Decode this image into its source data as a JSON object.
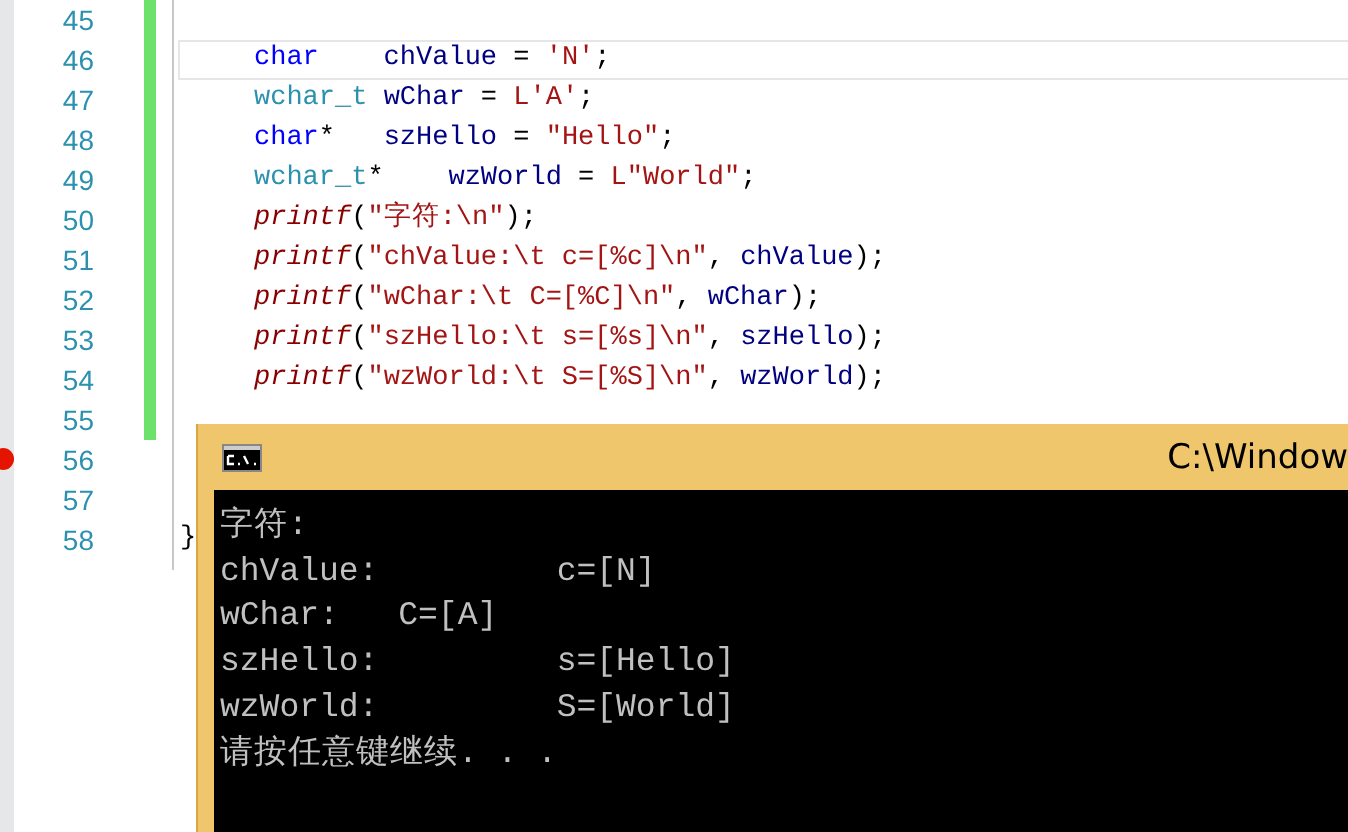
{
  "editor": {
    "lines": [
      {
        "number": "45",
        "indented": false,
        "current": false,
        "breakpoint": false
      },
      {
        "number": "46",
        "indented": true,
        "current": true,
        "breakpoint": false,
        "tokens": [
          {
            "kind": "keyword",
            "text": "char"
          },
          {
            "kind": "ident",
            "text": "    chValue"
          },
          {
            "kind": "plain",
            "text": " = "
          },
          {
            "kind": "string",
            "text": "'N'"
          },
          {
            "kind": "plain",
            "text": ";"
          }
        ]
      },
      {
        "number": "47",
        "indented": true,
        "current": false,
        "breakpoint": false,
        "tokens": [
          {
            "kind": "type",
            "text": "wchar_t"
          },
          {
            "kind": "ident",
            "text": " wChar"
          },
          {
            "kind": "plain",
            "text": " = "
          },
          {
            "kind": "string",
            "text": "L'A'"
          },
          {
            "kind": "plain",
            "text": ";"
          }
        ]
      },
      {
        "number": "48",
        "indented": true,
        "current": false,
        "breakpoint": false,
        "tokens": [
          {
            "kind": "keyword",
            "text": "char"
          },
          {
            "kind": "plain",
            "text": "*"
          },
          {
            "kind": "ident",
            "text": "   szHello"
          },
          {
            "kind": "plain",
            "text": " = "
          },
          {
            "kind": "string",
            "text": "\"Hello\""
          },
          {
            "kind": "plain",
            "text": ";"
          }
        ]
      },
      {
        "number": "49",
        "indented": true,
        "current": false,
        "breakpoint": false,
        "tokens": [
          {
            "kind": "type",
            "text": "wchar_t"
          },
          {
            "kind": "plain",
            "text": "*"
          },
          {
            "kind": "ident",
            "text": "    wzWorld"
          },
          {
            "kind": "plain",
            "text": " = "
          },
          {
            "kind": "string",
            "text": "L\"World\""
          },
          {
            "kind": "plain",
            "text": ";"
          }
        ]
      },
      {
        "number": "50",
        "indented": true,
        "current": false,
        "breakpoint": false,
        "tokens": [
          {
            "kind": "func",
            "text": "printf"
          },
          {
            "kind": "plain",
            "text": "("
          },
          {
            "kind": "string",
            "text": "\"字符:\\n\""
          },
          {
            "kind": "plain",
            "text": ");"
          }
        ]
      },
      {
        "number": "51",
        "indented": true,
        "current": false,
        "breakpoint": false,
        "tokens": [
          {
            "kind": "func",
            "text": "printf"
          },
          {
            "kind": "plain",
            "text": "("
          },
          {
            "kind": "string",
            "text": "\"chValue:\\t c=[%c]\\n\""
          },
          {
            "kind": "plain",
            "text": ", "
          },
          {
            "kind": "ident",
            "text": "chValue"
          },
          {
            "kind": "plain",
            "text": ");"
          }
        ]
      },
      {
        "number": "52",
        "indented": true,
        "current": false,
        "breakpoint": false,
        "tokens": [
          {
            "kind": "func",
            "text": "printf"
          },
          {
            "kind": "plain",
            "text": "("
          },
          {
            "kind": "string",
            "text": "\"wChar:\\t C=[%C]\\n\""
          },
          {
            "kind": "plain",
            "text": ", "
          },
          {
            "kind": "ident",
            "text": "wChar"
          },
          {
            "kind": "plain",
            "text": ");"
          }
        ]
      },
      {
        "number": "53",
        "indented": true,
        "current": false,
        "breakpoint": false,
        "tokens": [
          {
            "kind": "func",
            "text": "printf"
          },
          {
            "kind": "plain",
            "text": "("
          },
          {
            "kind": "string",
            "text": "\"szHello:\\t s=[%s]\\n\""
          },
          {
            "kind": "plain",
            "text": ", "
          },
          {
            "kind": "ident",
            "text": "szHello"
          },
          {
            "kind": "plain",
            "text": ");"
          }
        ]
      },
      {
        "number": "54",
        "indented": true,
        "current": false,
        "breakpoint": false,
        "tokens": [
          {
            "kind": "func",
            "text": "printf"
          },
          {
            "kind": "plain",
            "text": "("
          },
          {
            "kind": "string",
            "text": "\"wzWorld:\\t S=[%S]\\n\""
          },
          {
            "kind": "plain",
            "text": ", "
          },
          {
            "kind": "ident",
            "text": "wzWorld"
          },
          {
            "kind": "plain",
            "text": ");"
          }
        ]
      },
      {
        "number": "55",
        "indented": false,
        "current": false,
        "breakpoint": false
      },
      {
        "number": "56",
        "indented": false,
        "current": false,
        "breakpoint": true
      },
      {
        "number": "57",
        "indented": false,
        "current": false,
        "breakpoint": false
      },
      {
        "number": "58",
        "indented": false,
        "current": false,
        "breakpoint": false,
        "tokens": [
          {
            "kind": "plain",
            "text": "}"
          }
        ]
      }
    ]
  },
  "console": {
    "title": "C:\\Window",
    "output": [
      "字符:",
      "chValue:         c=[N]",
      "wChar:   C=[A]",
      "szHello:         s=[Hello]",
      "wzWorld:         S=[World]",
      "请按任意键继续. . ."
    ]
  }
}
